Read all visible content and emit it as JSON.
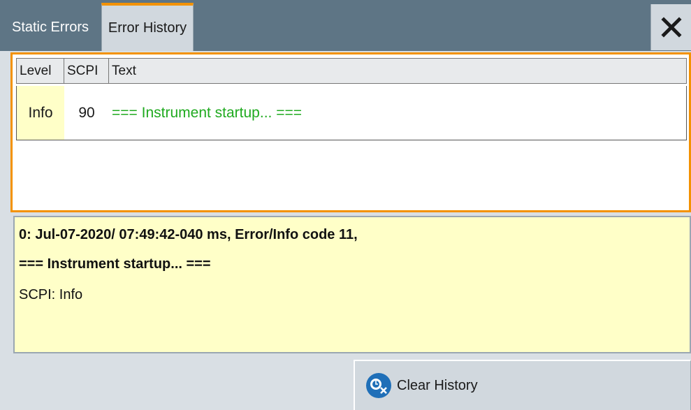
{
  "tabs": [
    {
      "label": "Static Errors",
      "active": false
    },
    {
      "label": "Error History",
      "active": true
    }
  ],
  "close_icon": "close-icon",
  "table": {
    "headers": [
      "Level",
      "SCPI",
      "Text"
    ],
    "rows": [
      {
        "level": "Info",
        "scpi": "90",
        "text": "=== Instrument startup... ==="
      }
    ]
  },
  "detail": {
    "line1": "0: Jul-07-2020/ 07:49:42-040 ms, Error/Info code 11,",
    "line2": "=== Instrument startup... ===",
    "line3": "SCPI: Info"
  },
  "clear_button": {
    "label": "Clear History",
    "icon": "clear-history-icon"
  },
  "colors": {
    "header": "#5e7585",
    "accent": "#f39200",
    "info_background": "#ffffc8",
    "text_green": "#1faa1f",
    "panel_background": "#d9dfe4"
  }
}
